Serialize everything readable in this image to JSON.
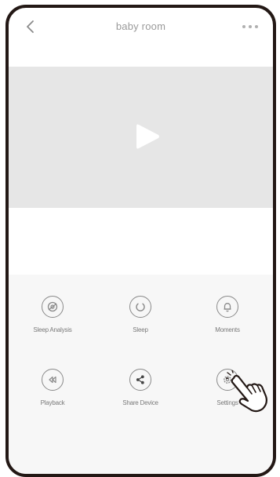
{
  "header": {
    "title": "baby room",
    "back_icon": "chevron-left-icon",
    "more_icon": "more-horizontal-icon"
  },
  "video": {
    "play_icon": "play-icon"
  },
  "controls": [
    {
      "label": "Sleep Analysis",
      "icon": "sleep-analysis-icon"
    },
    {
      "label": "Sleep",
      "icon": "power-icon"
    },
    {
      "label": "Moments",
      "icon": "bell-icon"
    },
    {
      "label": "Playback",
      "icon": "rewind-icon"
    },
    {
      "label": "Share Device",
      "icon": "share-icon"
    },
    {
      "label": "Settings",
      "icon": "gear-icon"
    }
  ],
  "colors": {
    "frame": "#231815",
    "video_bg": "#e6e6e6",
    "controls_bg": "#f7f7f7",
    "icon_stroke": "#8a8a8a",
    "title_text": "#9a9a9a"
  }
}
